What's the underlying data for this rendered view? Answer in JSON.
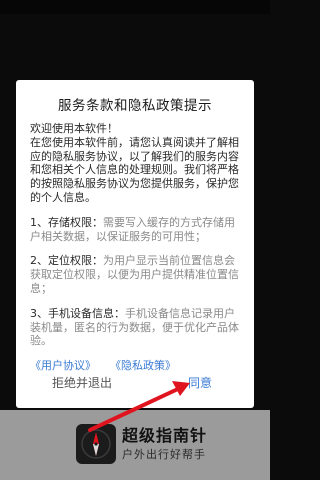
{
  "dialog": {
    "title": "服务条款和隐私政策提示",
    "greeting": "欢迎使用本软件！",
    "intro": "在您使用本软件前，请您认真阅读并了解相应的隐私服务协议，以了解我们的服务内容和您相关个人信息的处理规则。我们将严格的按照隐私服务协议为您提供服务，保护您的个人信息。",
    "permissions": [
      {
        "title": "1、存储权限：",
        "desc": "需要写入缓存的方式存储用户相关数据，以保证服务的可用性；"
      },
      {
        "title": "2、定位权限：",
        "desc": "为用户显示当前位置信息会获取定位权限，以便为用户提供精准位置信息；"
      },
      {
        "title": "3、手机设备信息：",
        "desc": "手机设备信息记录用户装机量，匿名的行为数据，便于优化产品体验。"
      }
    ],
    "user_agreement_link": "《用户协议》",
    "privacy_policy_link": "《隐私政策》",
    "reject_button": "拒绝并退出",
    "agree_button": "同意"
  },
  "app": {
    "name": "超级指南针",
    "slogan": "户外出行好帮手",
    "icon": "compass-icon"
  },
  "colors": {
    "link": "#3a7bd5",
    "annotation_arrow": "#e0141e",
    "bottom_bar": "#9b9b9b"
  }
}
